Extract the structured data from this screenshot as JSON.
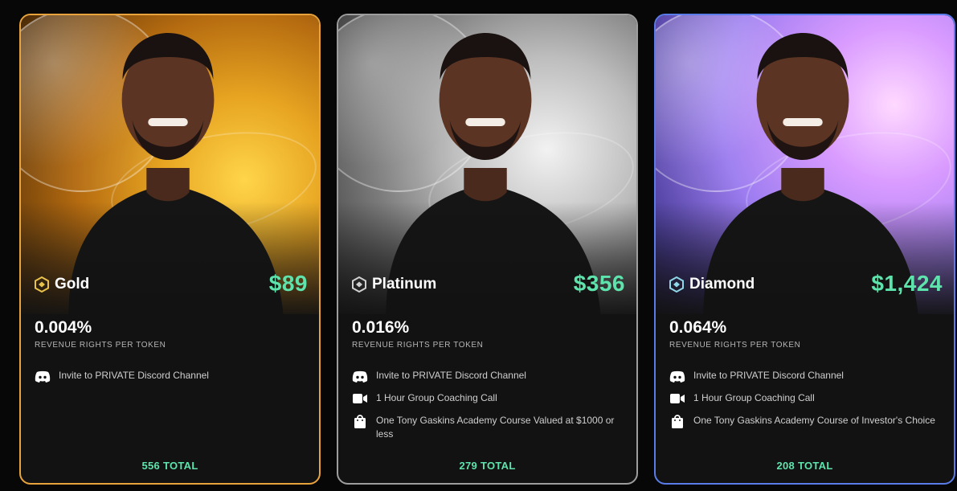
{
  "cards": [
    {
      "tier": "Gold",
      "price": "$89",
      "revenue_percent": "0.004%",
      "revenue_label": "REVENUE RIGHTS PER TOKEN",
      "perks": [
        "Invite to PRIVATE Discord Channel"
      ],
      "total": "556 TOTAL",
      "accent": "#e8a33c",
      "icon_color": "#e8c24a"
    },
    {
      "tier": "Platinum",
      "price": "$356",
      "revenue_percent": "0.016%",
      "revenue_label": "REVENUE RIGHTS PER TOKEN",
      "perks": [
        "Invite to PRIVATE Discord Channel",
        "1 Hour Group Coaching Call",
        "One Tony Gaskins Academy Course Valued at $1000 or less"
      ],
      "total": "279 TOTAL",
      "accent": "#9d9d9d",
      "icon_color": "#d0d0d0"
    },
    {
      "tier": "Diamond",
      "price": "$1,424",
      "revenue_percent": "0.064%",
      "revenue_label": "REVENUE RIGHTS PER TOKEN",
      "perks": [
        "Invite to PRIVATE Discord Channel",
        "1 Hour Group Coaching Call",
        "One Tony Gaskins Academy Course of Investor's Choice"
      ],
      "total": "208 TOTAL",
      "accent": "#5a7ce8",
      "icon_color": "#8fd6e8"
    }
  ],
  "colors": {
    "price": "#5fe3ac",
    "background": "#070707",
    "card": "#121212"
  },
  "icons": {
    "tier": "hexagon-token-icon",
    "perk_discord": "discord-icon",
    "perk_video": "video-camera-icon",
    "perk_course": "shopping-bag-icon"
  }
}
